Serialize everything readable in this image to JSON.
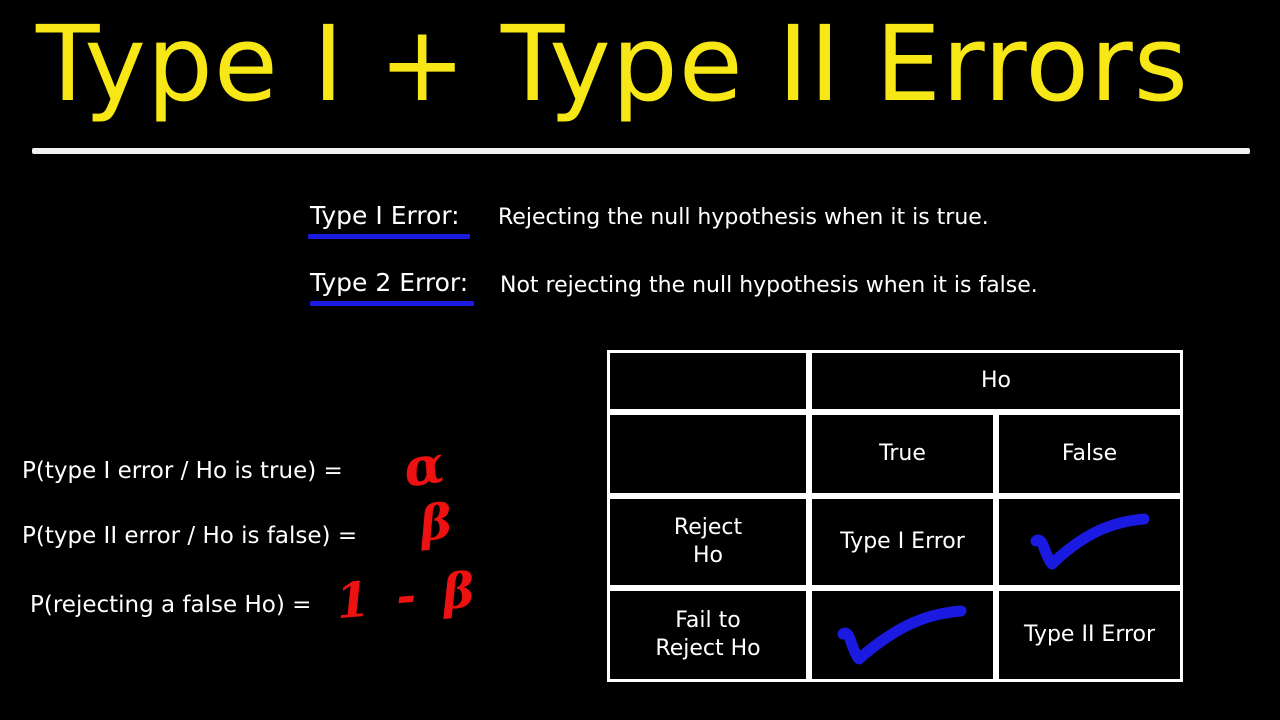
{
  "slide": {
    "title": "Type I + Type II Errors",
    "background_color": "#000000",
    "title_color": "#f7e717",
    "rule_color": "#f2f2f2"
  },
  "definitions": [
    {
      "label": "Type I Error:",
      "text": "Rejecting the null hypothesis when it is true.",
      "underline_color": "#1a1ae0"
    },
    {
      "label": "Type 2 Error:",
      "text": "Not rejecting the null hypothesis when it is false.",
      "underline_color": "#1a1ae0"
    }
  ],
  "formulas": [
    {
      "expression": "P(type I error / Ho is true)  =",
      "symbol": "α"
    },
    {
      "expression": "P(type II error / Ho is false)  =",
      "symbol": "β"
    },
    {
      "expression": "P(rejecting a false Ho) =",
      "symbol": "1 - β"
    }
  ],
  "formula_symbol_color": "#ee1111",
  "matrix": {
    "group_header": "Ho",
    "column_headers": [
      "True",
      "False"
    ],
    "column_header_color": "#e63946",
    "row_labels": [
      "Reject\nHo",
      "Fail to\nReject Ho"
    ],
    "row_labels_flat": [
      "Reject Ho",
      "Fail to Reject Ho"
    ],
    "rows": [
      {
        "label_line1": "Reject",
        "label_line2": "Ho",
        "cells": [
          {
            "kind": "text",
            "value": "Type I Error"
          },
          {
            "kind": "check",
            "value": "correct-decision-checkmark"
          }
        ]
      },
      {
        "label_line1": "Fail to",
        "label_line2": "Reject Ho",
        "cells": [
          {
            "kind": "check",
            "value": "correct-decision-checkmark"
          },
          {
            "kind": "text",
            "value": "Type II Error"
          }
        ]
      }
    ],
    "border_color": "#ffffff",
    "check_color": "#1a1ae0"
  }
}
